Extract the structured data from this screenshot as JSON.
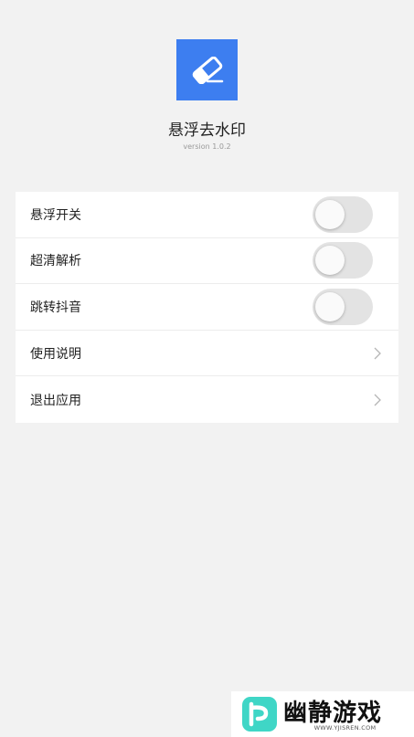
{
  "app": {
    "icon": "eraser-icon",
    "icon_bg": "#3d7ef0",
    "title": "悬浮去水印",
    "version": "version 1.0.2"
  },
  "settings": [
    {
      "label": "悬浮开关",
      "control": "toggle",
      "on": false
    },
    {
      "label": "超清解析",
      "control": "toggle",
      "on": false
    },
    {
      "label": "跳转抖音",
      "control": "toggle",
      "on": false
    },
    {
      "label": "使用说明",
      "control": "chevron"
    },
    {
      "label": "退出应用",
      "control": "chevron"
    }
  ],
  "watermark": {
    "brand": "幽静游戏",
    "url": "WWW.YJISREN.COM",
    "logo": "yj-logo",
    "accent": "#3fd6c6"
  }
}
